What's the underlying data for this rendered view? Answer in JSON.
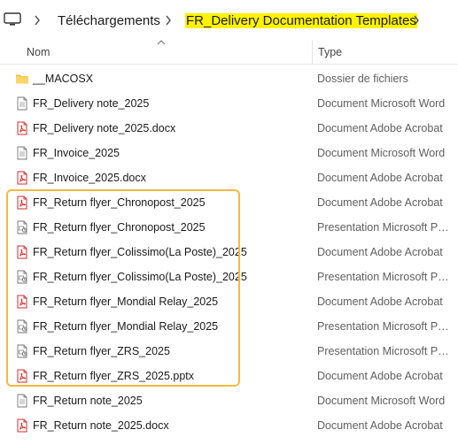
{
  "breadcrumb": {
    "root_icon": "computer-icon",
    "items": [
      "Téléchargements",
      "FR_Delivery Documentation Templates"
    ]
  },
  "header": {
    "name_label": "Nom",
    "type_label": "Type"
  },
  "files": [
    {
      "name": "__MACOSX",
      "type": "Dossier de fichiers",
      "icon": "folder-icon"
    },
    {
      "name": "FR_Delivery note_2025",
      "type": "Document Microsoft Word",
      "icon": "word-doc-icon"
    },
    {
      "name": "FR_Delivery note_2025.docx",
      "type": "Document Adobe Acrobat",
      "icon": "pdf-icon"
    },
    {
      "name": "FR_Invoice_2025",
      "type": "Document Microsoft Word",
      "icon": "word-doc-icon"
    },
    {
      "name": "FR_Invoice_2025.docx",
      "type": "Document Adobe Acrobat",
      "icon": "pdf-icon"
    },
    {
      "name": "FR_Return flyer_Chronopost_2025",
      "type": "Document Adobe Acrobat",
      "icon": "pdf-icon"
    },
    {
      "name": "FR_Return flyer_Chronopost_2025",
      "type": "Presentation Microsoft Po...",
      "icon": "powerpoint-icon"
    },
    {
      "name": "FR_Return flyer_Colissimo(La Poste)_2025",
      "type": "Document Adobe Acrobat",
      "icon": "pdf-icon"
    },
    {
      "name": "FR_Return flyer_Colissimo(La Poste)_2025",
      "type": "Presentation Microsoft Po...",
      "icon": "powerpoint-icon"
    },
    {
      "name": "FR_Return flyer_Mondial Relay_2025",
      "type": "Document Adobe Acrobat",
      "icon": "pdf-icon"
    },
    {
      "name": "FR_Return flyer_Mondial Relay_2025",
      "type": "Presentation Microsoft Po...",
      "icon": "powerpoint-icon"
    },
    {
      "name": "FR_Return flyer_ZRS_2025",
      "type": "Presentation Microsoft Po...",
      "icon": "powerpoint-icon"
    },
    {
      "name": "FR_Return flyer_ZRS_2025.pptx",
      "type": "Document Adobe Acrobat",
      "icon": "pdf-icon"
    },
    {
      "name": "FR_Return note_2025",
      "type": "Document Microsoft Word",
      "icon": "word-doc-icon"
    },
    {
      "name": "FR_Return note_2025.docx",
      "type": "Document Adobe Acrobat",
      "icon": "pdf-icon"
    }
  ],
  "colors": {
    "highlight_current": "#fff300",
    "selection_border": "#f5b942",
    "pdf_red": "#d92b2b",
    "folder_yellow": "#f6c343"
  }
}
